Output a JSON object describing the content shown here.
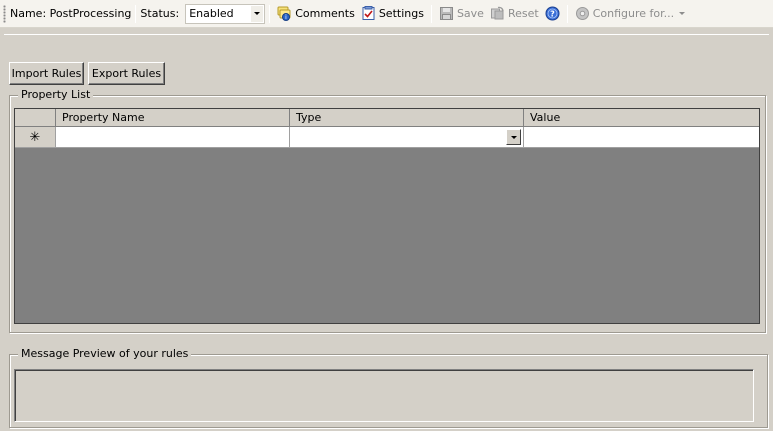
{
  "toolbar": {
    "name_label": "Name: PostProcessing",
    "status_label": "Status:",
    "status_value": "Enabled",
    "comments_label": "Comments",
    "settings_label": "Settings",
    "save_label": "Save",
    "reset_label": "Reset",
    "configure_label": "Configure for..."
  },
  "buttons": {
    "import_rules": "Import Rules",
    "export_rules": "Export Rules"
  },
  "property_list": {
    "title": "Property List",
    "columns": [
      "Property Name",
      "Type",
      "Value"
    ],
    "new_row_marker": "✳"
  },
  "message_preview": {
    "title": "Message Preview of your rules"
  }
}
